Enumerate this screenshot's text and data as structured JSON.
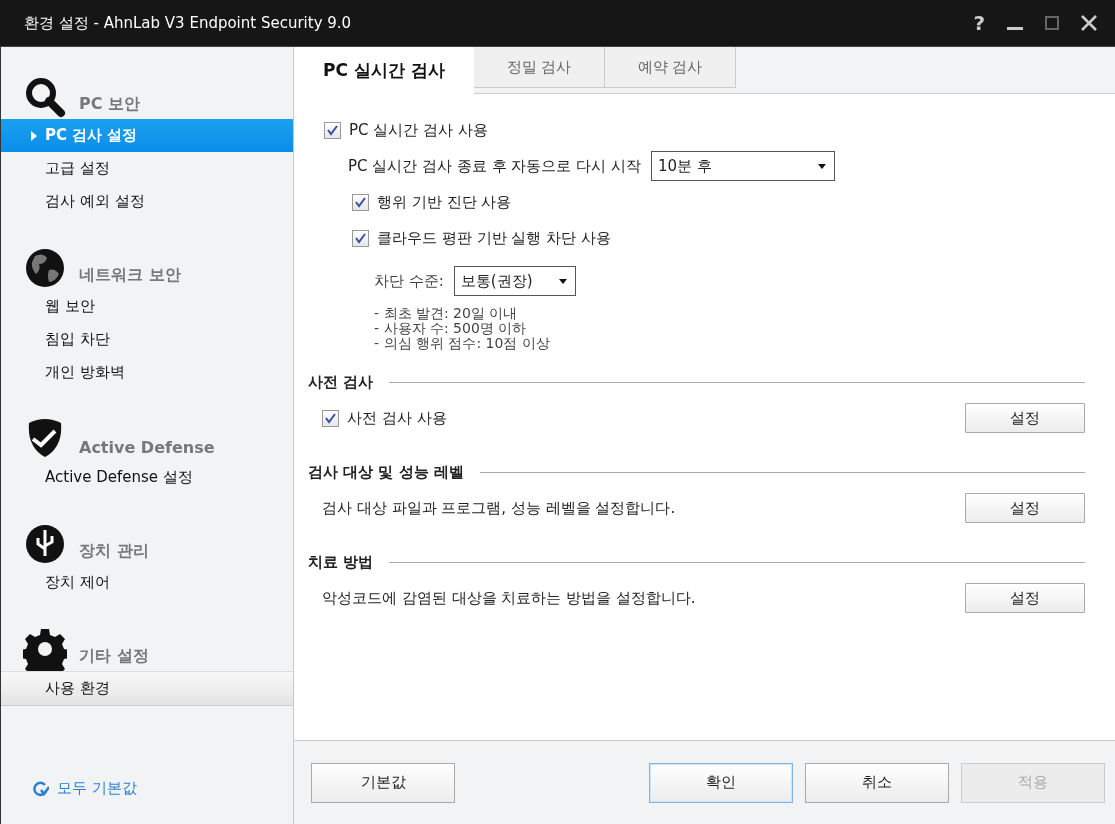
{
  "window": {
    "title": "환경 설정 - AhnLab V3 Endpoint Security 9.0",
    "help": "?"
  },
  "sidebar": {
    "sections": [
      {
        "kind": "search",
        "title": "PC 보안",
        "items": [
          {
            "label": "PC 검사 설정",
            "selected": true,
            "highlighted": false
          },
          {
            "label": "고급 설정",
            "selected": false,
            "highlighted": false
          },
          {
            "label": "검사 예외 설정",
            "selected": false,
            "highlighted": false
          }
        ]
      },
      {
        "kind": "globe",
        "title": "네트워크 보안",
        "items": [
          {
            "label": "웹 보안",
            "selected": false,
            "highlighted": false
          },
          {
            "label": "침입 차단",
            "selected": false,
            "highlighted": false
          },
          {
            "label": "개인 방화벽",
            "selected": false,
            "highlighted": false
          }
        ]
      },
      {
        "kind": "shield",
        "title": "Active Defense",
        "items": [
          {
            "label": "Active Defense 설정",
            "selected": false,
            "highlighted": false
          }
        ]
      },
      {
        "kind": "usb",
        "title": "장치 관리",
        "items": [
          {
            "label": "장치 제어",
            "selected": false,
            "highlighted": false
          }
        ]
      },
      {
        "kind": "gear",
        "title": "기타 설정",
        "items": [
          {
            "label": "사용 환경",
            "selected": false,
            "highlighted": true
          }
        ]
      }
    ],
    "reset_link": "모두 기본값"
  },
  "tabs": [
    {
      "label": "PC 실시간 검사",
      "selected": true
    },
    {
      "label": "정밀 검사",
      "selected": false
    },
    {
      "label": "예약 검사",
      "selected": false
    }
  ],
  "realtime": {
    "enable": {
      "label": "PC 실시간 검사 사용",
      "checked": true
    },
    "restart": {
      "label": "PC 실시간 검사 종료 후 자동으로 다시 시작",
      "value": "10분 후"
    },
    "options": [
      {
        "label": "행위 기반 진단 사용",
        "checked": true
      },
      {
        "label": "클라우드 평판 기반 실행 차단 사용",
        "checked": true
      }
    ],
    "block_level": {
      "label": "차단 수준:",
      "value": "보통(권장)"
    },
    "criteria": [
      "- 최초 발견: 20일 이내",
      "- 사용자 수: 500명 이하",
      "- 의심 행위 점수: 10점 이상"
    ]
  },
  "sections": [
    {
      "title": "사전 검사",
      "checkbox": {
        "label": "사전 검사 사용",
        "checked": true
      },
      "button": "설정"
    },
    {
      "title": "검사 대상 및 성능 레벨",
      "description": "검사 대상 파일과 프로그램, 성능 레벨을 설정합니다.",
      "button": "설정"
    },
    {
      "title": "치료 방법",
      "description": "악성코드에 감염된 대상을 치료하는 방법을 설정합니다.",
      "button": "설정"
    }
  ],
  "footer": {
    "left_button": "기본값",
    "buttons": [
      {
        "label": "확인",
        "focused": true,
        "disabled": false
      },
      {
        "label": "취소",
        "focused": false,
        "disabled": false
      },
      {
        "label": "적용",
        "focused": false,
        "disabled": true
      }
    ]
  }
}
